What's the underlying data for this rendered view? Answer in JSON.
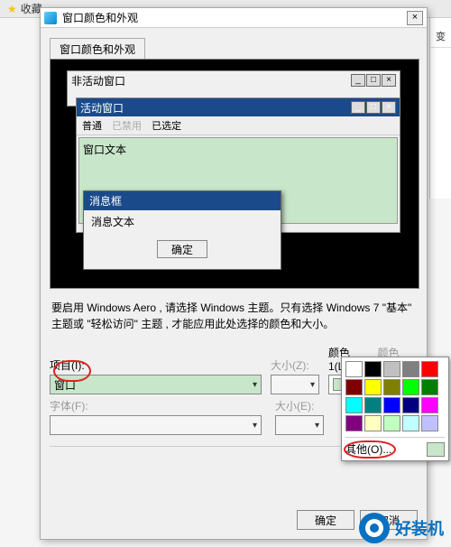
{
  "browser": {
    "fav_label": "收藏"
  },
  "side": {
    "item": "变"
  },
  "dialog": {
    "title": "窗口颜色和外观",
    "tab": "窗口颜色和外观",
    "desc": "要启用 Windows Aero , 请选择 Windows 主题。只有选择 Windows 7 \"基本\" 主题或 \"轻松访问\" 主题 , 才能应用此处选择的颜色和大小。",
    "item_label": "项目(I):",
    "item_value": "窗口",
    "size_label": "大小(Z):",
    "color1_label": "颜色 1(L):",
    "color2_label": "颜色 2(2):",
    "font_label": "字体(F):",
    "fontsize_label": "大小(E):",
    "ok": "确定",
    "cancel": "取消"
  },
  "preview": {
    "inactive": "非活动窗口",
    "active": "活动窗口",
    "menu_normal": "普通",
    "menu_disabled": "已禁用",
    "menu_selected": "已选定",
    "window_text": "窗口文本",
    "msgbox_title": "消息框",
    "msgbox_text": "消息文本",
    "msgbox_ok": "确定"
  },
  "palette": {
    "other": "其他(O)...",
    "colors": [
      "#ffffff",
      "#000000",
      "#c0c0c0",
      "#808080",
      "#ff0000",
      "#800000",
      "#ffff00",
      "#808000",
      "#00ff00",
      "#008000",
      "#00ffff",
      "#008080",
      "#0000ff",
      "#000080",
      "#ff00ff",
      "#800080",
      "#ffffc0",
      "#c0ffc0",
      "#c0ffff",
      "#c0c0ff"
    ]
  },
  "watermark": {
    "text": "好装机"
  }
}
